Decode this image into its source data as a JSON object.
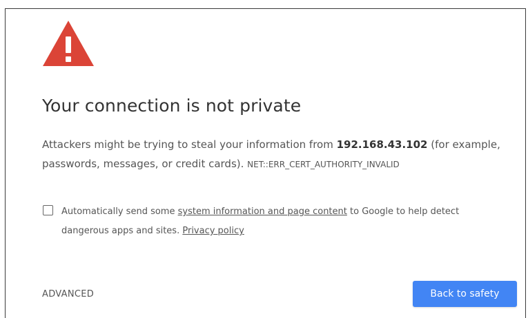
{
  "page": {
    "title": "Your connection is not private",
    "description": {
      "before_host": "Attackers might be trying to steal your information from ",
      "host": "192.168.43.102",
      "after_host": " (for example, passwords, messages, or credit cards). ",
      "error_code": "NET::ERR_CERT_AUTHORITY_INVALID"
    },
    "opt_in": {
      "checked": false,
      "text_before_link": "Automatically send some ",
      "link_text": "system information and page content",
      "text_after_link": " to Google to help detect dangerous apps and sites. ",
      "privacy_link": "Privacy policy"
    },
    "advanced_label": "ADVANCED",
    "primary_button": "Back to safety"
  },
  "icons": {
    "warning": "warning-triangle-icon"
  },
  "colors": {
    "warning_red": "#db4437",
    "button_blue": "#4285f4",
    "text": "#333333"
  }
}
